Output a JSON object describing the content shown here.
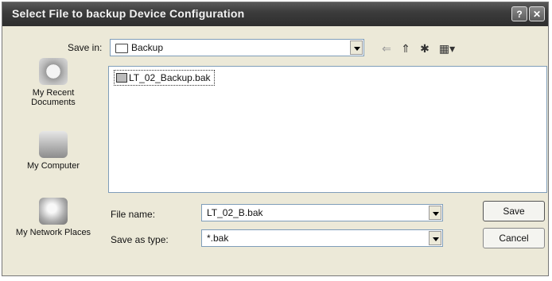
{
  "window": {
    "title": "Select File to backup Device Configuration",
    "help_label": "?",
    "close_label": "✕"
  },
  "save_in": {
    "label": "Save in:",
    "value": "Backup"
  },
  "toolbar": {
    "back_glyph": "⇐",
    "up_glyph": "⇑",
    "newfolder_glyph": "✱",
    "views_glyph": "▦▾"
  },
  "files": [
    {
      "name": "LT_02_Backup.bak"
    }
  ],
  "places": [
    {
      "label": "My Recent Documents",
      "icon": "recent-documents-icon"
    },
    {
      "label": "My Computer",
      "icon": "my-computer-icon"
    },
    {
      "label": "My Network Places",
      "icon": "network-places-icon"
    }
  ],
  "filename": {
    "label": "File name:",
    "value": "LT_02_B.bak"
  },
  "filetype": {
    "label": "Save as type:",
    "value": "*.bak"
  },
  "buttons": {
    "save": "Save",
    "cancel": "Cancel"
  }
}
